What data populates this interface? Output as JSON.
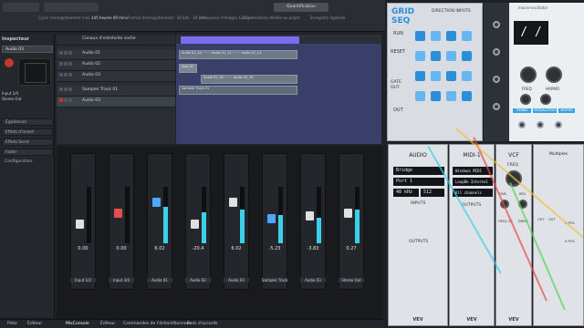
{
  "daw": {
    "topbar": {
      "status_items": [
        "Cycle d'enregistrement max : ",
        "145 heures 49 mins",
        "Format d'enregistrement : 24 bits - 24 bits",
        "Fréquence d'images : 30 ips",
        "Lu de résolution dédiée au projet",
        "Enregistre égalisée"
      ],
      "quantize_label": "Quantification"
    },
    "inspector": {
      "title": "Inspecteur",
      "track_name": "Audio 03",
      "routing": [
        "Input 1/4",
        "Stereo Out"
      ],
      "sections": [
        "Égaliseurs",
        "Effets d'insert",
        "Effets Send",
        "Fader",
        "Configuration"
      ]
    },
    "tracks": [
      {
        "name": "Canaux d'entrée/de sortie"
      },
      {
        "name": "Audio 01"
      },
      {
        "name": "Audio 02"
      },
      {
        "name": "Audio 03"
      },
      {
        "name": "Sampler Track 01"
      },
      {
        "name": "Audio 03"
      }
    ],
    "clips": [
      {
        "label": "Audio 01_14 ~~~ Audio 01_14 ~~~ Audio 01_14"
      },
      {
        "label": "Add_01"
      },
      {
        "label": "Audio 02_16 ~~~ Audio 02_16"
      },
      {
        "label": "Sampler Track 01"
      }
    ],
    "mixer": {
      "channels": [
        {
          "name": "Input 1/2",
          "db": "0.00",
          "level": 0.35,
          "fader_color": "#e0e0e0",
          "meter": 0.0
        },
        {
          "name": "Input 3/4",
          "db": "0.00",
          "level": 0.55,
          "fader_color": "#e05050",
          "meter": 0.0
        },
        {
          "name": "Audio 01",
          "db": "6.02",
          "level": 0.75,
          "fader_color": "#4da6ff",
          "meter": 0.65
        },
        {
          "name": "Audio 02",
          "db": "-20.4",
          "level": 0.35,
          "fader_color": "#e0e0e0",
          "meter": 0.55
        },
        {
          "name": "Audio 03",
          "db": "6.02",
          "level": 0.75,
          "fader_color": "#e0e0e0",
          "meter": 0.6
        },
        {
          "name": "Sampler Track 0",
          "db": "-5.23",
          "level": 0.45,
          "fader_color": "#4da6ff",
          "meter": 0.5
        },
        {
          "name": "Audio 03",
          "db": "-3.83",
          "level": 0.5,
          "fader_color": "#e0e0e0",
          "meter": 0.45
        },
        {
          "name": "Stereo Out",
          "db": "0.27",
          "level": 0.55,
          "fader_color": "#e0e0e0",
          "meter": 0.6
        }
      ]
    },
    "bottom_tabs": [
      "Piste",
      "Éditeur",
      "MixConsole",
      "Éditeur",
      "Commandes de l'échantillonneur",
      "Pads d'accords"
    ]
  },
  "vcv": {
    "grid_seq": {
      "title": "GRID",
      "title2": "SEQ",
      "subtitle": "DIRECTION INPUTS",
      "run": "RUN",
      "reset": "RESET",
      "gate_out": "GATE OUT",
      "out": "OUT"
    },
    "macro_osc": {
      "title": "macro-oscillator",
      "display": "/ /",
      "labels": [
        "FREQ",
        "HARMO",
        "TIMBRE",
        "MODULATION",
        "MORPH"
      ]
    },
    "audio": {
      "title": "AUDIO",
      "lines": [
        "Bridge",
        "Port 1",
        "48 kHz",
        "512"
      ],
      "inputs_label": "INPUTS",
      "outputs_label": "OUTPUTS"
    },
    "midi": {
      "title": "MIDI-1",
      "lines": [
        "Windows MIDI",
        "LoopBe Internal",
        "All channels"
      ],
      "outputs_label": "OUTPUTS"
    },
    "vcf": {
      "title": "VCF",
      "freq": "FREQ",
      "labels": [
        "FINE",
        "RES",
        "FREQ CV",
        "DRIVE"
      ]
    },
    "multiples": {
      "title": "Multiples",
      "labels": [
        "OUT",
        "OUT",
        "X POS",
        "X POS"
      ]
    },
    "brand": "VEV"
  }
}
